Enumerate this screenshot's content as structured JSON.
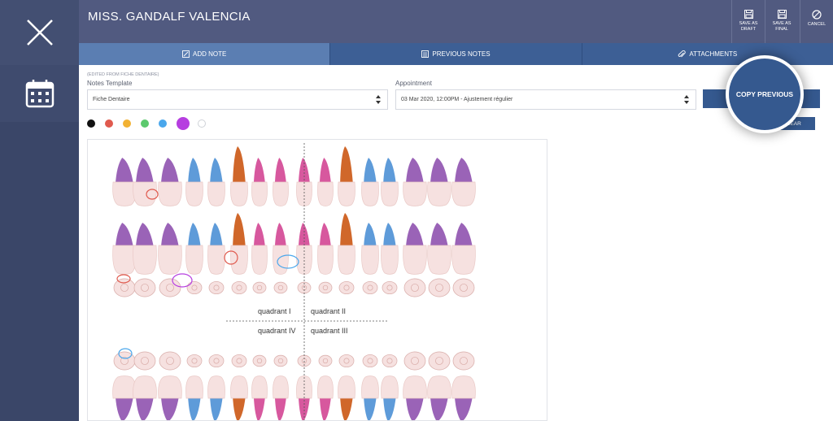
{
  "patient": {
    "name": "MISS. GANDALF VALENCIA"
  },
  "header_actions": [
    {
      "label": "SAVE AS DRAFT",
      "icon": "floppy-icon"
    },
    {
      "label": "SAVE AS FINAL",
      "icon": "floppy-icon"
    },
    {
      "label": "CANCEL",
      "icon": "cancel-icon"
    }
  ],
  "tabs": [
    {
      "label": "ADD NOTE",
      "icon": "pencil-icon",
      "active": true
    },
    {
      "label": "PREVIOUS NOTES",
      "icon": "list-icon",
      "active": false
    },
    {
      "label": "ATTACHMENTS",
      "icon": "paperclip-icon",
      "active": false
    }
  ],
  "form": {
    "edited_from": "(EDITED FROM FICHE DENTAIRE)",
    "notes_template_label": "Notes Template",
    "notes_template_value": "Fiche Dentaire",
    "appointment_label": "Appointment",
    "appointment_value": "03 Mar 2020, 12:00PM - Ajustement régulier",
    "copy_previous_label": "COPY PREVIOUS",
    "clear_label": "CLEAR"
  },
  "palette": [
    {
      "color": "#111111",
      "selected": false
    },
    {
      "color": "#e05a4e",
      "selected": false
    },
    {
      "color": "#f2b233",
      "selected": false
    },
    {
      "color": "#5cc96e",
      "selected": false
    },
    {
      "color": "#4aa7ec",
      "selected": false
    },
    {
      "color": "#b63ee0",
      "selected": true
    },
    {
      "color": "#ffffff",
      "selected": false
    }
  ],
  "dental_chart": {
    "quadrants": [
      "quadrant I",
      "quadrant II",
      "quadrant IV",
      "quadrant III"
    ],
    "colors": {
      "enamel": "#f6e1e0",
      "molar_root": "#9a63b7",
      "premolar_root": "#5e9bd9",
      "canine_root": "#d0672a",
      "incisor_root": "#d7589e"
    }
  }
}
